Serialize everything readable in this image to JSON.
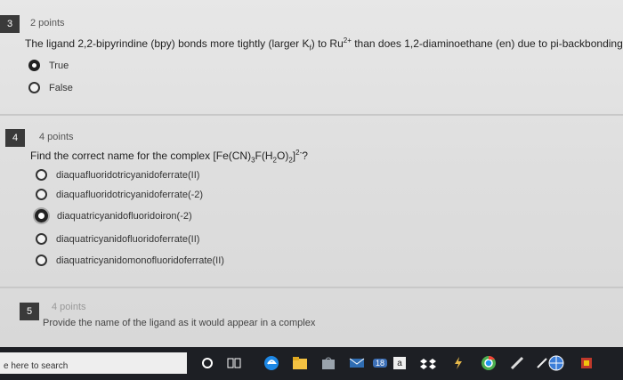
{
  "q3": {
    "number": "3",
    "points": "2 points",
    "text_before": "The ligand 2,2-bipyrindine (bpy) bonds more tightly (larger K",
    "text_sub": "f",
    "text_mid": ") to Ru",
    "text_sup": "2+",
    "text_after": " than does 1,2-diaminoethane (en) due to pi-backbonding",
    "options": [
      "True",
      "False"
    ]
  },
  "q4": {
    "number": "4",
    "points": "4 points",
    "text": "Find the correct name for the complex [Fe(CN)",
    "formula_sub1": "3",
    "formula_mid": "F(H",
    "formula_sub2": "2",
    "formula_mid2": "O)",
    "formula_sub3": "2",
    "formula_end": "]",
    "formula_sup": "2-",
    "formula_tail": "?",
    "options": [
      "diaquafluoridotricyanidoferrate(II)",
      "diaquafluoridotricyanidoferrate(-2)",
      "diaquatricyanidofluoridoiron(-2)",
      "diaquatricyanidofluoridoferrate(II)",
      "diaquatricyanidomonofluoridoferrate(II)"
    ],
    "selected_index": 2
  },
  "q5": {
    "number": "5",
    "points": "4 points",
    "text": "Provide the name of the ligand as it would appear in a complex"
  },
  "taskbar": {
    "search_text": "e here to search",
    "badge": "18",
    "icons": [
      "circle-icon",
      "task-view-icon",
      "edge-icon",
      "file-explorer-icon",
      "store-icon",
      "mail-icon",
      "app-icon",
      "amazon-icon",
      "dropbox-icon",
      "flash-icon",
      "chrome-icon",
      "pen-icon",
      "globe-icon",
      "game-icon"
    ]
  }
}
